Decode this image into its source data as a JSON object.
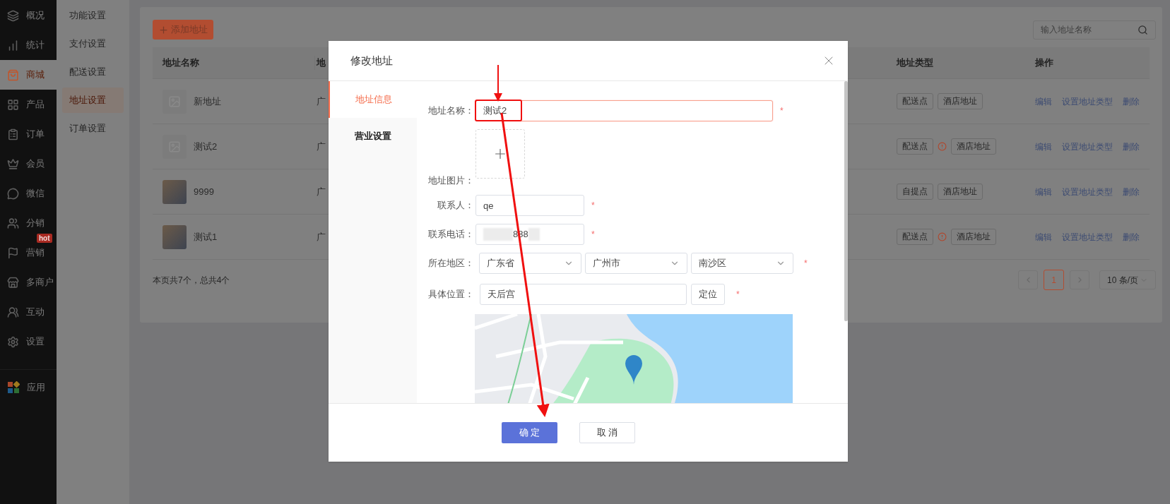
{
  "nav": {
    "items": [
      {
        "label": "概况",
        "selected": false
      },
      {
        "label": "统计",
        "selected": false
      },
      {
        "label": "商城",
        "selected": true
      },
      {
        "label": "产品",
        "selected": false
      },
      {
        "label": "订单",
        "selected": false
      },
      {
        "label": "会员",
        "selected": false
      },
      {
        "label": "微信",
        "selected": false
      },
      {
        "label": "分销",
        "selected": false
      },
      {
        "label": "营销",
        "selected": false,
        "badge": "hot"
      },
      {
        "label": "多商户",
        "selected": false
      },
      {
        "label": "互动",
        "selected": false
      },
      {
        "label": "设置",
        "selected": false
      },
      {
        "label": "应用",
        "selected": false
      }
    ]
  },
  "subnav": {
    "items": [
      {
        "label": "功能设置",
        "selected": false
      },
      {
        "label": "支付设置",
        "selected": false
      },
      {
        "label": "配送设置",
        "selected": false
      },
      {
        "label": "地址设置",
        "selected": true
      },
      {
        "label": "订单设置",
        "selected": false
      }
    ]
  },
  "toolbar": {
    "add_button": "添加地址",
    "search": {
      "placeholder": "输入地址名称"
    }
  },
  "table": {
    "columns": [
      "地址名称",
      "地",
      "地址类型",
      "操作"
    ],
    "rows": [
      {
        "image": {
          "kind": "placeholder"
        },
        "name": "新地址",
        "column_2": "广",
        "types": [
          {
            "label": "配送点",
            "warning": false
          },
          {
            "label": "酒店地址",
            "warning": false
          }
        ],
        "actions": [
          "编辑",
          "设置地址类型",
          "删除"
        ]
      },
      {
        "image": {
          "kind": "placeholder"
        },
        "name": "测试2",
        "column_2": "广",
        "types": [
          {
            "label": "配送点",
            "warning": true
          },
          {
            "label": "酒店地址",
            "warning": false
          }
        ],
        "actions": [
          "编辑",
          "设置地址类型",
          "删除"
        ]
      },
      {
        "image": {
          "kind": "photo"
        },
        "name": "9999",
        "column_2": "广",
        "types": [
          {
            "label": "自提点",
            "warning": false
          },
          {
            "label": "酒店地址",
            "warning": false
          }
        ],
        "actions": [
          "编辑",
          "设置地址类型",
          "删除"
        ]
      },
      {
        "image": {
          "kind": "photo"
        },
        "name": "测试1",
        "column_2": "广",
        "types": [
          {
            "label": "配送点",
            "warning": true
          },
          {
            "label": "酒店地址",
            "warning": false
          }
        ],
        "actions": [
          "编辑",
          "设置地址类型",
          "删除"
        ]
      }
    ]
  },
  "footer": {
    "summary": "本页共7个，总共4个",
    "pages": [
      {
        "label": "1",
        "selected": true
      }
    ],
    "page_size": "10 条/页"
  },
  "dialog": {
    "title": "修改地址",
    "tabs": [
      {
        "label": "地址信息",
        "selected": true
      },
      {
        "label": "营业设置",
        "selected": false
      }
    ],
    "fields": [
      {
        "kind": "wide_input",
        "label": "地址名称：",
        "value": "测试2",
        "required_mark": "*",
        "focused": true
      },
      {
        "kind": "upload",
        "label": "地址图片："
      },
      {
        "kind": "input",
        "label": "联系人：",
        "value": "qe",
        "required_mark": "*",
        "focused": false
      },
      {
        "kind": "redacted_input",
        "label": "联系电话：",
        "value": "888",
        "required_mark": "*",
        "focused": false
      },
      {
        "kind": "selects",
        "label": "所在地区：",
        "options": [
          "广东省",
          "广州市",
          "南沙区"
        ],
        "required_mark": "*"
      },
      {
        "kind": "locate",
        "label": "具体位置：",
        "value": "天后宫",
        "button": "定位",
        "required_mark": "*"
      },
      {
        "kind": "map"
      }
    ],
    "buttons": [
      {
        "label": "确 定",
        "kind": "primary"
      },
      {
        "label": "取 消",
        "kind": "default"
      }
    ]
  }
}
